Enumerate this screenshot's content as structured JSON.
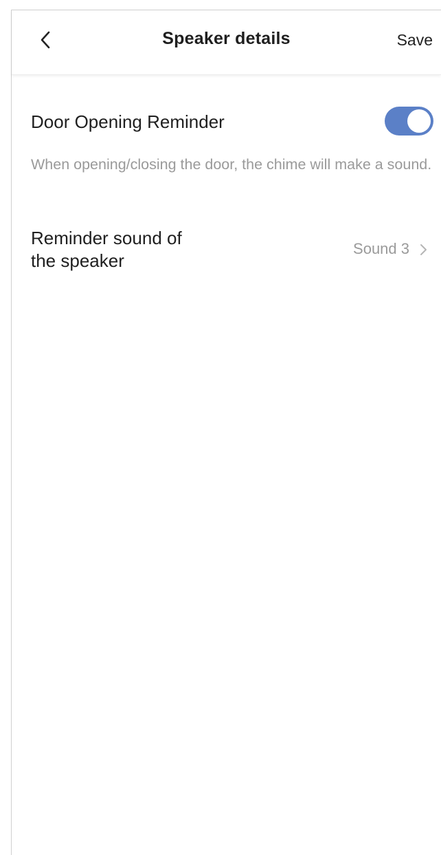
{
  "header": {
    "title": "Speaker details",
    "save_label": "Save",
    "back_icon": "chevron-left-icon"
  },
  "door_reminder": {
    "label": "Door Opening Reminder",
    "enabled": true,
    "description": "When opening/closing the door, the chime will make a sound."
  },
  "reminder_sound": {
    "label_line1": "Reminder sound of",
    "label_line2": "the speaker",
    "value": "Sound 3",
    "chevron_icon": "chevron-right-icon"
  },
  "colors": {
    "toggle_on": "#5b80c7",
    "text_primary": "#1f1f1f",
    "text_secondary": "#9a9a9a"
  }
}
